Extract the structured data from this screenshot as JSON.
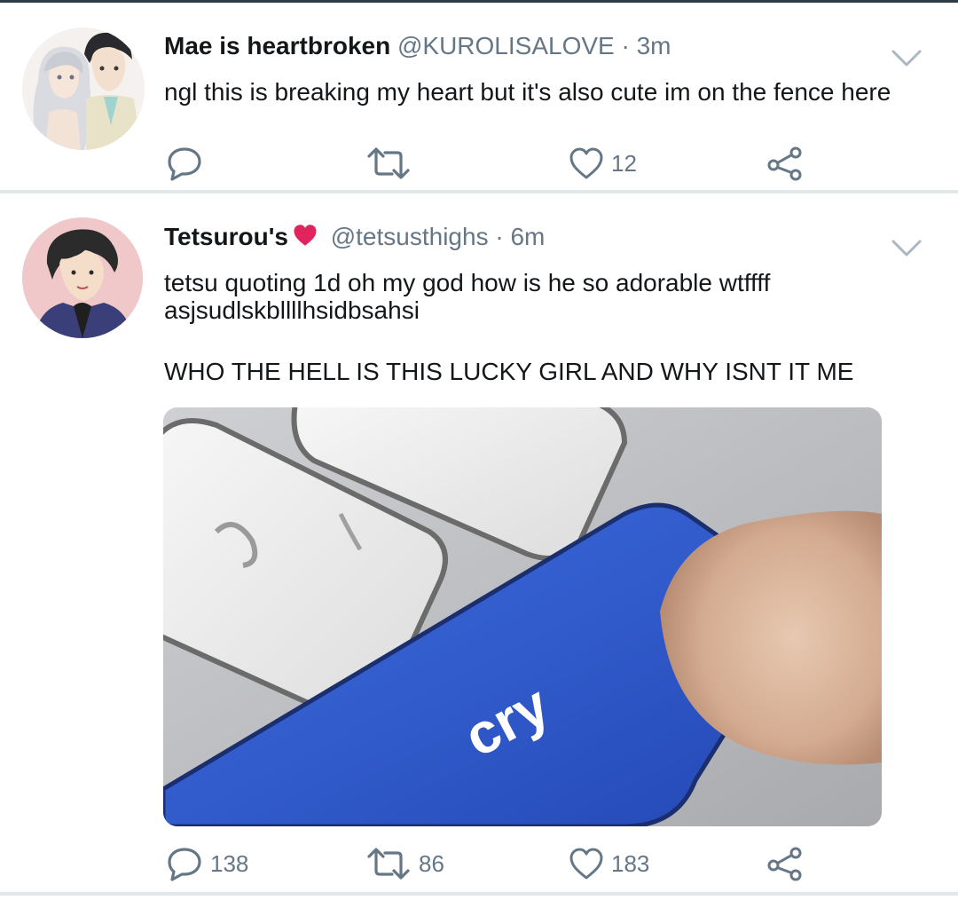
{
  "tweets": [
    {
      "name": "Mae is heartbroken",
      "handle": "@KUROLISALOVE",
      "separator": "·",
      "time": "3m",
      "text_lines": [
        "ngl this is breaking my heart but it's also cute im on the fence here"
      ],
      "counts": {
        "replies": "",
        "retweets": "",
        "likes": "12"
      }
    },
    {
      "name": "Tetsurou's",
      "name_emoji": "red-heart",
      "handle": "@tetsusthighs",
      "separator": "·",
      "time": "6m",
      "text_lines": [
        "tetsu quoting 1d oh my god how is he so adorable wtffff",
        "asjsudlskbllllhsidbsahsi",
        "WHO THE HELL IS THIS LUCKY GIRL AND WHY ISNT IT ME"
      ],
      "media": {
        "key_label": "cry",
        "key_color": "#2d5bd0"
      },
      "counts": {
        "replies": "138",
        "retweets": "86",
        "likes": "183"
      }
    }
  ],
  "icons": {
    "reply": "reply-icon",
    "retweet": "retweet-icon",
    "like": "heart-icon",
    "share": "share-icon",
    "menu": "chevron-down-icon"
  },
  "colors": {
    "icon_gray": "#657786",
    "text": "#14171a",
    "divider": "#e3e7ea",
    "heart_red": "#e0245e"
  }
}
